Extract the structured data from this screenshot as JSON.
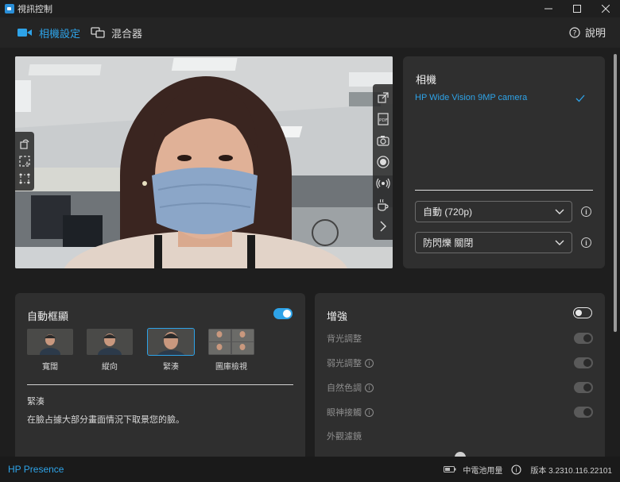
{
  "window": {
    "title": "視訊控制",
    "minimize_icon": "minimize-icon",
    "maximize_icon": "maximize-icon",
    "close_icon": "close-icon"
  },
  "nav": {
    "tabs": [
      {
        "label": "相機設定",
        "icon": "camera-icon",
        "active": true
      },
      {
        "label": "混合器",
        "icon": "mixer-icon",
        "active": false
      }
    ],
    "help_label": "說明"
  },
  "preview": {
    "left_tools": [
      "rotate-icon",
      "auto-frame-icon",
      "region-select-icon"
    ],
    "right_tools": [
      "pop-out-icon",
      "pdf-icon",
      "snapshot-icon",
      "record-icon",
      "broadcast-icon",
      "coffee-break-icon",
      "expand-arrow-icon"
    ]
  },
  "camera": {
    "title": "相機",
    "device": "HP Wide Vision 9MP camera",
    "resolution": "自動 (720p)",
    "flicker": "防閃爍 關閉"
  },
  "framing": {
    "title": "自動框顯",
    "enabled": true,
    "options": [
      {
        "label": "寬闊",
        "selected": false
      },
      {
        "label": "縱向",
        "selected": false
      },
      {
        "label": "緊湊",
        "selected": true
      },
      {
        "label": "圖庫檢視",
        "selected": false
      }
    ],
    "selected_title": "緊湊",
    "selected_desc": "在臉占據大部分畫面情況下取景您的臉。"
  },
  "enhance": {
    "title": "增強",
    "enabled": false,
    "rows": [
      {
        "label": "背光調整",
        "info": false
      },
      {
        "label": "弱光調整",
        "info": true
      },
      {
        "label": "自然色調",
        "info": true
      },
      {
        "label": "眼神接觸",
        "info": true
      }
    ],
    "filter_label": "外觀濾鏡"
  },
  "status": {
    "brand": "HP Presence",
    "battery": "中電池用量",
    "version": "版本 3.2310.116.22101"
  },
  "colors": {
    "accent": "#2ea3e8",
    "panel": "#2f2f2f",
    "background": "#1e1e1e"
  }
}
